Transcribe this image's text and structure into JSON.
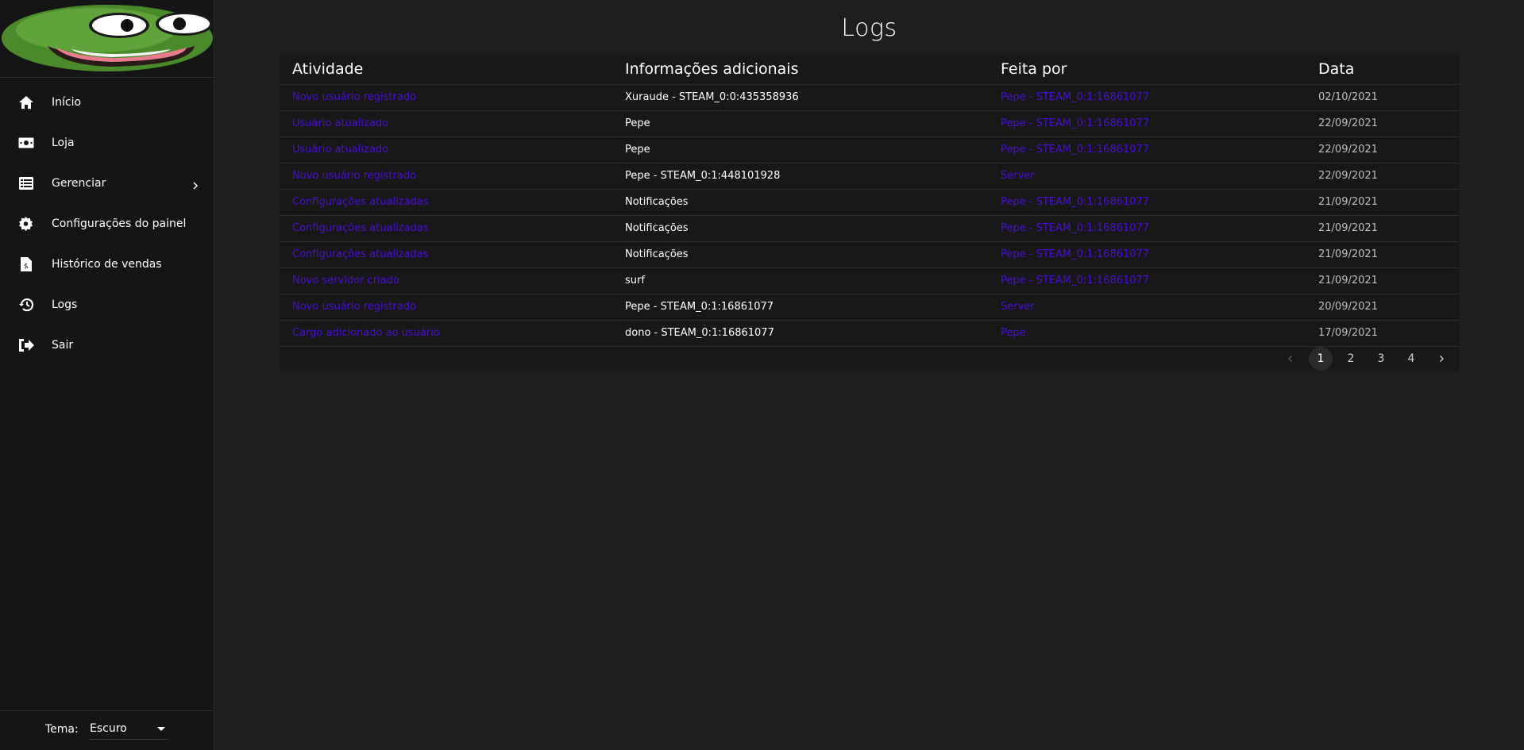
{
  "page": {
    "title": "Logs"
  },
  "sidebar": {
    "items": [
      {
        "label": "Início",
        "icon": "home-icon"
      },
      {
        "label": "Loja",
        "icon": "money-icon"
      },
      {
        "label": "Gerenciar",
        "icon": "list-icon"
      },
      {
        "label": "Configurações do painel",
        "icon": "gear-icon"
      },
      {
        "label": "Histórico de vendas",
        "icon": "invoice-icon"
      },
      {
        "label": "Logs",
        "icon": "history-icon"
      },
      {
        "label": "Sair",
        "icon": "sign-out-icon"
      }
    ],
    "theme": {
      "label": "Tema:",
      "value": "Escuro"
    }
  },
  "table": {
    "columns": [
      "Atividade",
      "Informações adicionais",
      "Feita por",
      "Data"
    ],
    "rows": [
      [
        "Novo usuário registrado",
        "Xuraude - STEAM_0:0:435358936",
        "Pepe - STEAM_0:1:16861077",
        "02/10/2021"
      ],
      [
        "Usuário atualizado",
        "Pepe",
        "Pepe - STEAM_0:1:16861077",
        "22/09/2021"
      ],
      [
        "Usuário atualizado",
        "Pepe",
        "Pepe - STEAM_0:1:16861077",
        "22/09/2021"
      ],
      [
        "Novo usuário registrado",
        "Pepe - STEAM_0:1:448101928",
        "Server",
        "22/09/2021"
      ],
      [
        "Configurações atualizadas",
        "Notificações",
        "Pepe - STEAM_0:1:16861077",
        "21/09/2021"
      ],
      [
        "Configurações atualizadas",
        "Notificações",
        "Pepe - STEAM_0:1:16861077",
        "21/09/2021"
      ],
      [
        "Configurações atualizadas",
        "Notificações",
        "Pepe - STEAM_0:1:16861077",
        "21/09/2021"
      ],
      [
        "Novo servidor criado",
        "surf",
        "Pepe - STEAM_0:1:16861077",
        "21/09/2021"
      ],
      [
        "Novo usuário registrado",
        "Pepe - STEAM_0:1:16861077",
        "Server",
        "20/09/2021"
      ],
      [
        "Cargo adicionado ao usuário",
        "dono - STEAM_0:1:16861077",
        "Pepe",
        "17/09/2021"
      ]
    ]
  },
  "pagination": {
    "pages": [
      "1",
      "2",
      "3",
      "4"
    ],
    "current": "1"
  },
  "colors": {
    "link": "#4b0fd6",
    "background": "#1e1e1e",
    "sidebar": "#151515"
  }
}
